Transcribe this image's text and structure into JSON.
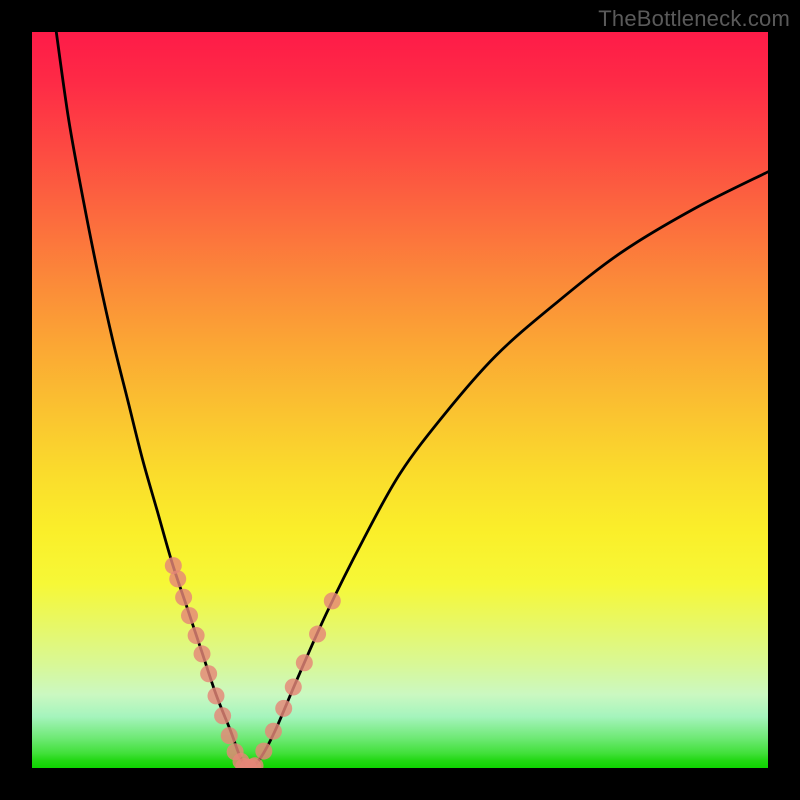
{
  "watermark": "TheBottleneck.com",
  "colors": {
    "frame_bg": "#000000",
    "gradient_top": "#fe1b48",
    "gradient_bottom": "#0ed400",
    "curve_stroke": "#000000",
    "marker_fill": "#e58677",
    "marker_stroke": "#c5604f"
  },
  "chart_data": {
    "type": "line",
    "title": "",
    "xlabel": "",
    "ylabel": "",
    "xlim": [
      0,
      100
    ],
    "ylim": [
      0,
      100
    ],
    "grid": false,
    "legend": false,
    "series": [
      {
        "name": "bottleneck-curve",
        "x": [
          3.3,
          5,
          7,
          9,
          11,
          13,
          15,
          17,
          19,
          21,
          23,
          25,
          27,
          28.3,
          29.5,
          31,
          33,
          36,
          40,
          45,
          50,
          56,
          63,
          71,
          80,
          90,
          100
        ],
        "y": [
          100,
          88,
          77,
          67,
          58,
          50,
          42,
          35,
          28,
          22,
          16,
          10,
          5,
          1.5,
          0,
          1.3,
          5,
          12,
          21,
          31,
          40,
          48,
          56,
          63,
          70,
          76,
          81
        ]
      },
      {
        "name": "left-scatter",
        "x": [
          19.2,
          19.8,
          20.6,
          21.4,
          22.3,
          23.1,
          24.0,
          25.0,
          25.9,
          26.8,
          27.6,
          28.4
        ],
        "y": [
          27.5,
          25.7,
          23.2,
          20.7,
          18.0,
          15.5,
          12.8,
          9.8,
          7.1,
          4.4,
          2.2,
          0.9
        ]
      },
      {
        "name": "right-scatter",
        "x": [
          30.3,
          31.5,
          32.8,
          34.2,
          35.5,
          37.0,
          38.8,
          40.8
        ],
        "y": [
          0.3,
          2.3,
          5.0,
          8.1,
          11.0,
          14.3,
          18.2,
          22.7
        ]
      },
      {
        "name": "bottom-scatter",
        "x": [
          28.8,
          29.4,
          30.0
        ],
        "y": [
          0.2,
          0.1,
          0.15
        ]
      }
    ],
    "background_gradient": {
      "direction": "vertical",
      "stops": [
        {
          "pos": 0.0,
          "color": "#fe1b48"
        },
        {
          "pos": 0.25,
          "color": "#fc6a3e"
        },
        {
          "pos": 0.5,
          "color": "#fac430"
        },
        {
          "pos": 0.75,
          "color": "#f6f837"
        },
        {
          "pos": 0.9,
          "color": "#cbf8c1"
        },
        {
          "pos": 1.0,
          "color": "#0ed400"
        }
      ]
    }
  }
}
